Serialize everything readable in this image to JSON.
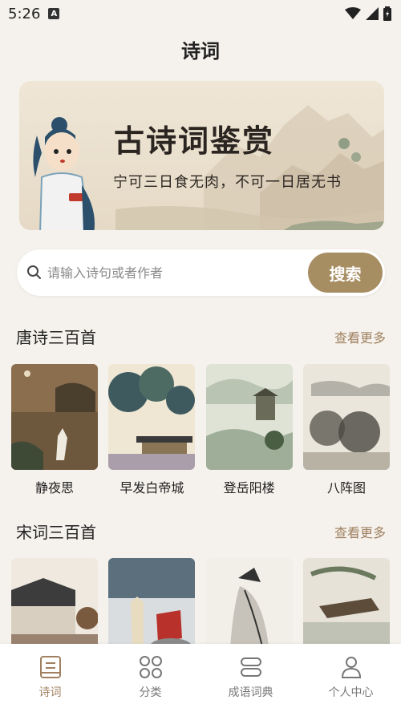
{
  "status_bar": {
    "time": "5:26"
  },
  "header": {
    "title": "诗词"
  },
  "banner": {
    "title": "古诗词鉴赏",
    "subtitle": "宁可三日食无肉，不可一日居无书"
  },
  "search": {
    "placeholder": "请输入诗句或者作者",
    "button_label": "搜索"
  },
  "sections": [
    {
      "title": "唐诗三百首",
      "more_label": "查看更多",
      "items": [
        {
          "label": "静夜思"
        },
        {
          "label": "早发白帝城"
        },
        {
          "label": "登岳阳楼"
        },
        {
          "label": "八阵图"
        }
      ]
    },
    {
      "title": "宋词三百首",
      "more_label": "查看更多",
      "items": [
        {},
        {},
        {},
        {}
      ]
    }
  ],
  "tabbar": {
    "items": [
      {
        "label": "诗词",
        "icon": "book-icon",
        "active": true
      },
      {
        "label": "分类",
        "icon": "grid-icon",
        "active": false
      },
      {
        "label": "成语词典",
        "icon": "dictionary-icon",
        "active": false
      },
      {
        "label": "个人中心",
        "icon": "person-icon",
        "active": false
      }
    ]
  },
  "colors": {
    "accent": "#a78d62",
    "background": "#f5f2ed",
    "tab_active": "#a08060"
  }
}
